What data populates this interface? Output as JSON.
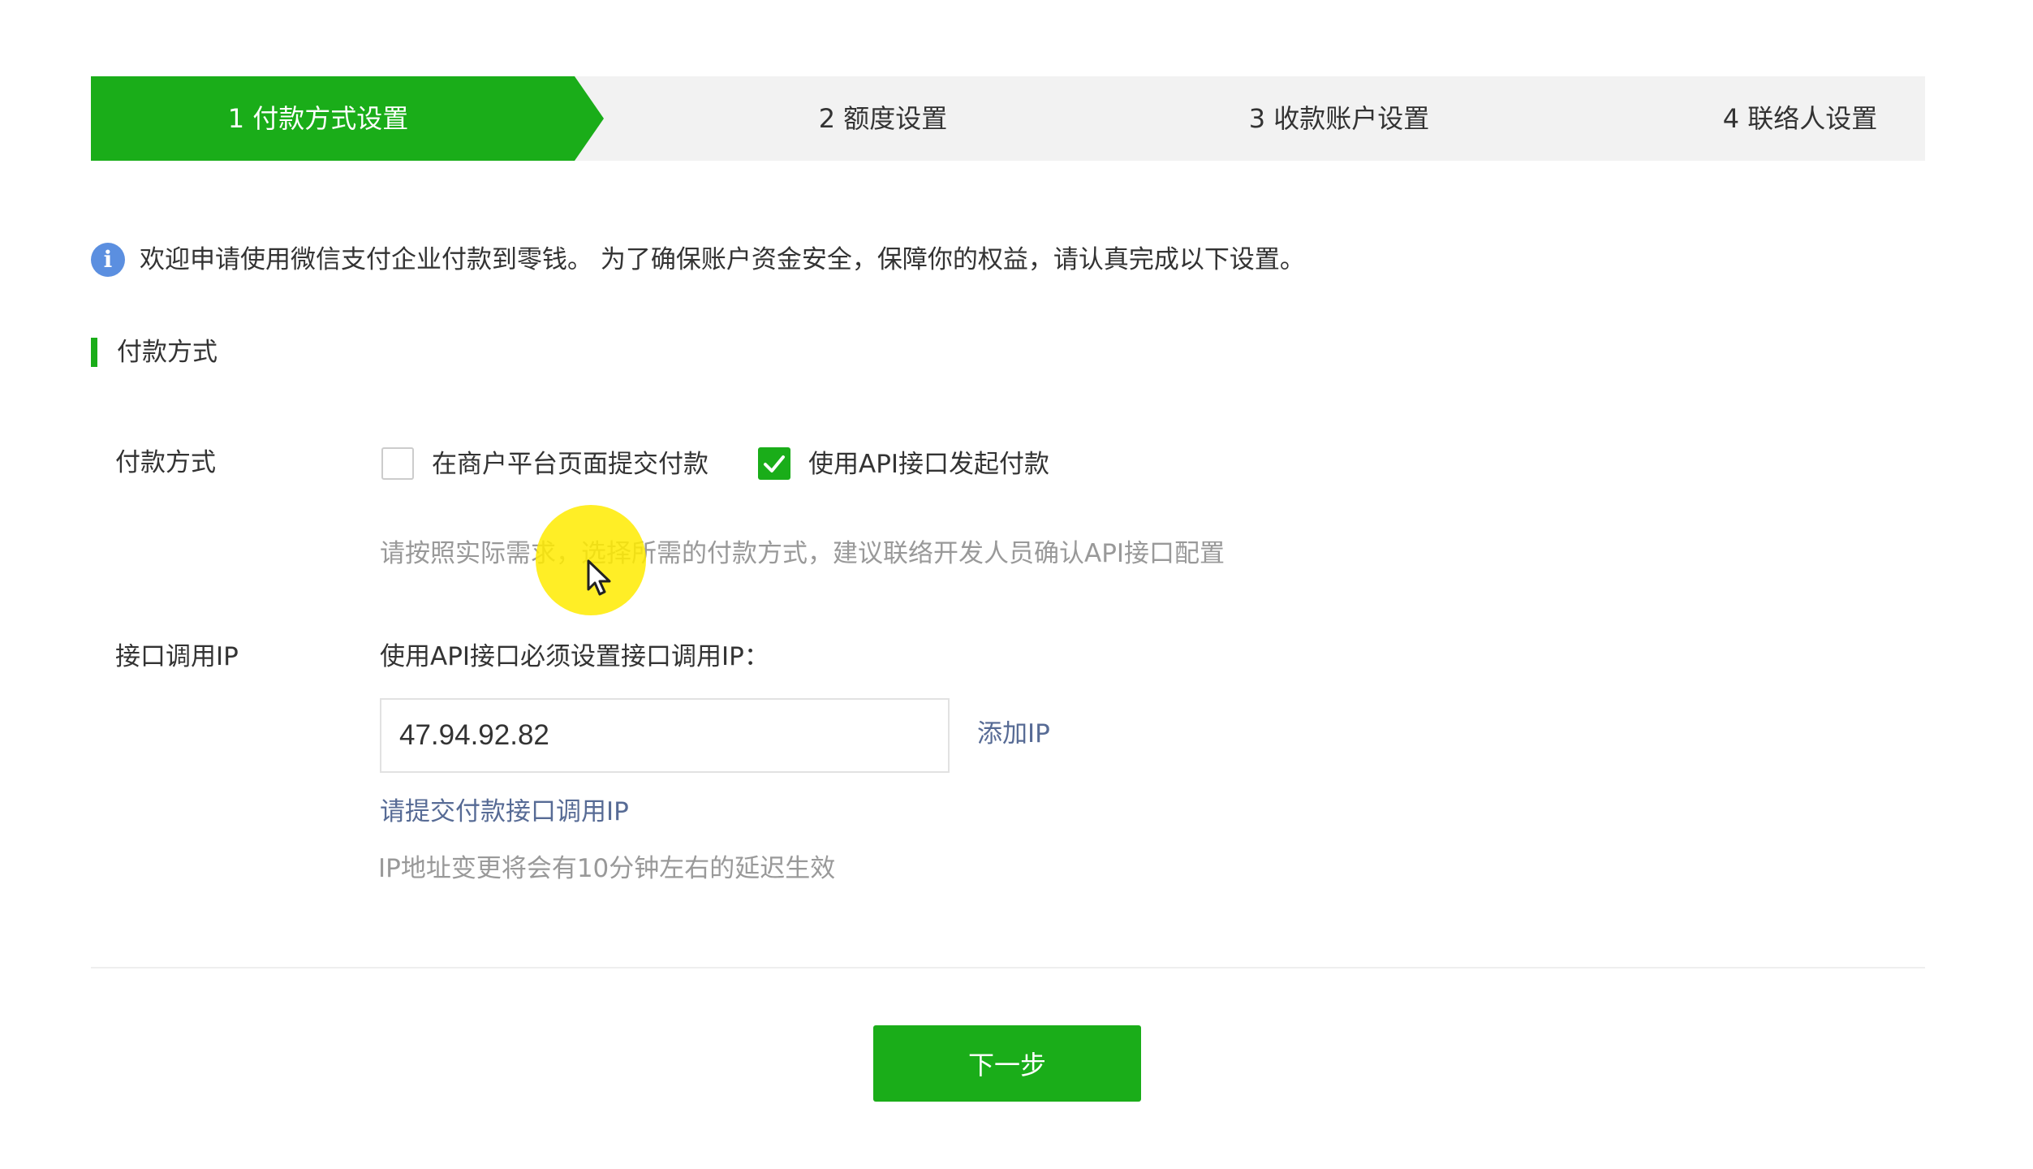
{
  "stepper": {
    "steps": [
      {
        "label": "1 付款方式设置"
      },
      {
        "label": "2 额度设置"
      },
      {
        "label": "3 收款账户设置"
      },
      {
        "label": "4 联络人设置"
      }
    ]
  },
  "info": {
    "text": "欢迎申请使用微信支付企业付款到零钱。 为了确保账户资金安全，保障你的权益，请认真完成以下设置。"
  },
  "section": {
    "title": "付款方式"
  },
  "payment_method": {
    "label": "付款方式",
    "options": [
      {
        "label": "在商户平台页面提交付款",
        "checked": false
      },
      {
        "label": "使用API接口发起付款",
        "checked": true
      }
    ],
    "hint": "请按照实际需求，选择所需的付款方式，建议联络开发人员确认API接口配置"
  },
  "api_ip": {
    "label": "接口调用IP",
    "description": "使用API接口必须设置接口调用IP：",
    "value": "47.94.92.82",
    "add_link": "添加IP",
    "submit_link": "请提交付款接口调用IP",
    "note": "IP地址变更将会有10分钟左右的延迟生效"
  },
  "footer": {
    "next_label": "下一步"
  },
  "colors": {
    "primary": "#1aad19",
    "link": "#576b95",
    "info": "#5b8fe0"
  }
}
